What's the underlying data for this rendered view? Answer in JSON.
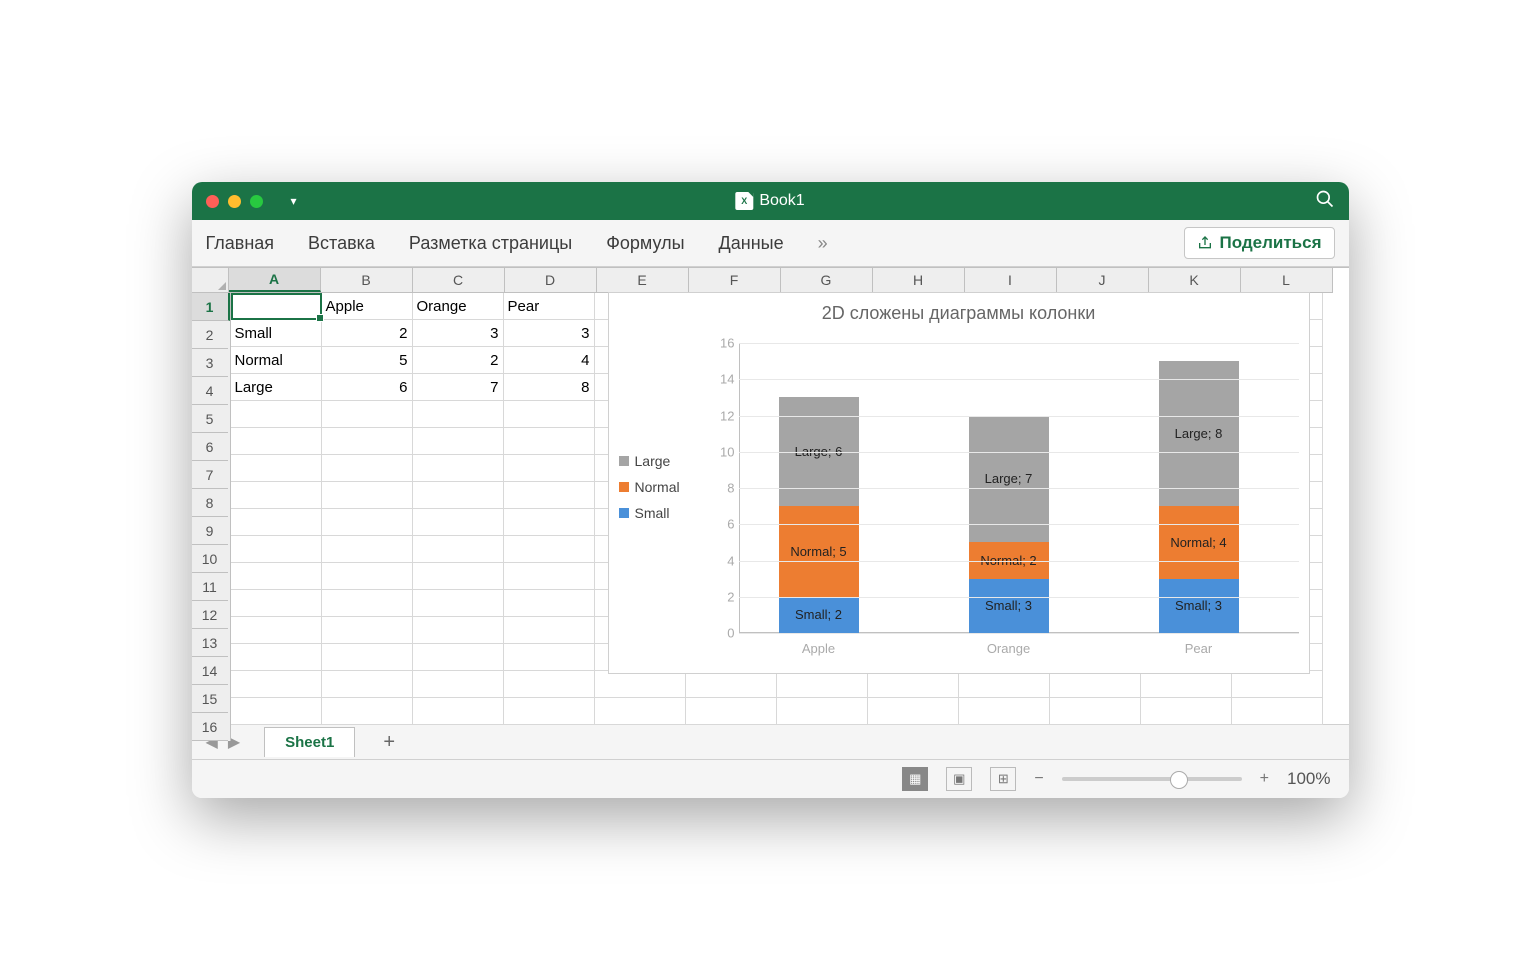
{
  "title": "Book1",
  "ribbon": {
    "tabs": [
      "Главная",
      "Вставка",
      "Разметка страницы",
      "Формулы",
      "Данные"
    ],
    "more": "»",
    "share": "Поделиться"
  },
  "columns": [
    "A",
    "B",
    "C",
    "D",
    "E",
    "F",
    "G",
    "H",
    "I",
    "J",
    "K",
    "L"
  ],
  "rows": [
    "1",
    "2",
    "3",
    "4",
    "5",
    "6",
    "7",
    "8",
    "9",
    "10",
    "11",
    "12",
    "13",
    "14",
    "15",
    "16"
  ],
  "grid": {
    "B1": "Apple",
    "C1": "Orange",
    "D1": "Pear",
    "A2": "Small",
    "B2": "2",
    "C2": "3",
    "D2": "3",
    "A3": "Normal",
    "B3": "5",
    "C3": "2",
    "D3": "4",
    "A4": "Large",
    "B4": "6",
    "C4": "7",
    "D4": "8"
  },
  "chart_data": {
    "type": "bar",
    "stacked": true,
    "title": "2D сложены диаграммы колонки",
    "categories": [
      "Apple",
      "Orange",
      "Pear"
    ],
    "series": [
      {
        "name": "Small",
        "values": [
          2,
          3,
          3
        ],
        "color": "#4a90d9"
      },
      {
        "name": "Normal",
        "values": [
          5,
          2,
          4
        ],
        "color": "#ed7d31"
      },
      {
        "name": "Large",
        "values": [
          6,
          7,
          8
        ],
        "color": "#a5a5a5"
      }
    ],
    "ylim": [
      0,
      16
    ],
    "ystep": 2,
    "legend_order": [
      "Large",
      "Normal",
      "Small"
    ],
    "data_labels": [
      [
        "Small; 2",
        "Normal; 5",
        "Large; 6"
      ],
      [
        "Small; 3",
        "Normal; 2",
        "Large; 7"
      ],
      [
        "Small; 3",
        "Normal; 4",
        "Large; 8"
      ]
    ]
  },
  "sheet_tab": "Sheet1",
  "zoom": "100%"
}
